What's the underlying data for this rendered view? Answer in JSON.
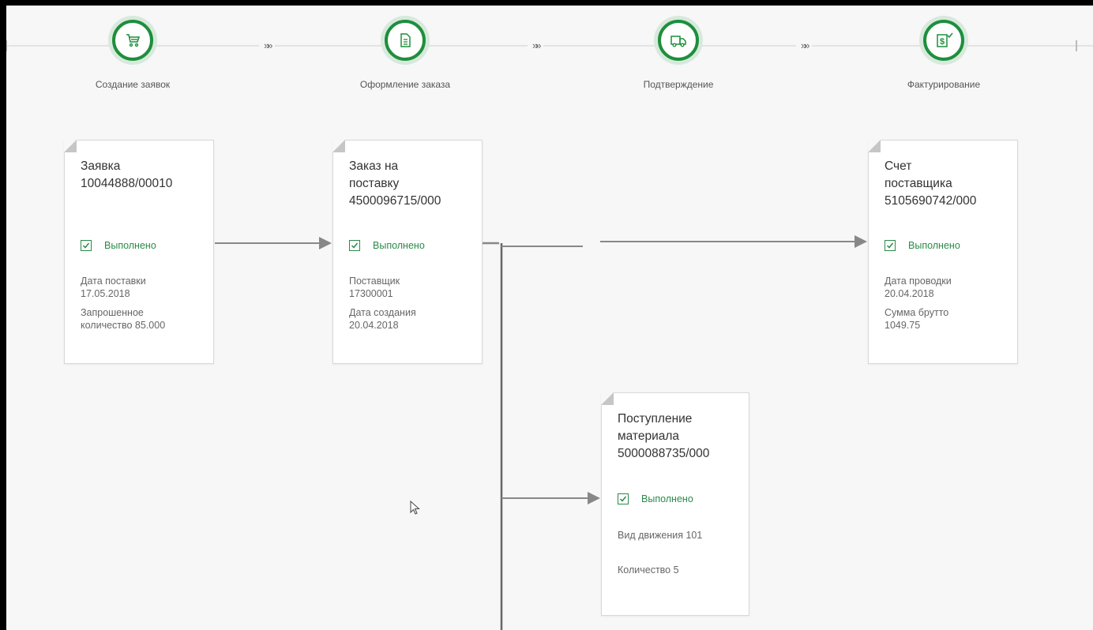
{
  "colors": {
    "accent": "#1e8f3c",
    "status_text": "#2a8a48",
    "background": "#f7f7f7",
    "connector": "#888888"
  },
  "process_steps": [
    {
      "label": "Создание заявок",
      "icon": "cart-icon"
    },
    {
      "label": "Оформление заказа",
      "icon": "document-form-icon"
    },
    {
      "label": "Подтверждение",
      "icon": "truck-icon"
    },
    {
      "label": "Фактурирование",
      "icon": "invoice-dollar-icon"
    }
  ],
  "step_separator": "»»",
  "cards": {
    "requisition": {
      "title": "Заявка\n10044888/00010",
      "status": "Выполнено",
      "fields": [
        "Дата поставки\n17.05.2018",
        "Запрошенное\nколичество 85.000"
      ]
    },
    "purchase_order": {
      "title": "Заказ на\nпоставку\n4500096715/000",
      "status": "Выполнено",
      "fields": [
        "Поставщик\n17300001",
        "Дата создания\n20.04.2018"
      ]
    },
    "supplier_invoice": {
      "title": "Счет\nпоставщика\n5105690742/000",
      "status": "Выполнено",
      "fields": [
        "Дата проводки\n20.04.2018",
        "Сумма брутто\n1049.75"
      ]
    },
    "goods_receipt": {
      "title": "Поступление\nматериала\n5000088735/000",
      "status": "Выполнено",
      "fields": [
        "Вид движения 101",
        "Количество 5"
      ]
    }
  }
}
